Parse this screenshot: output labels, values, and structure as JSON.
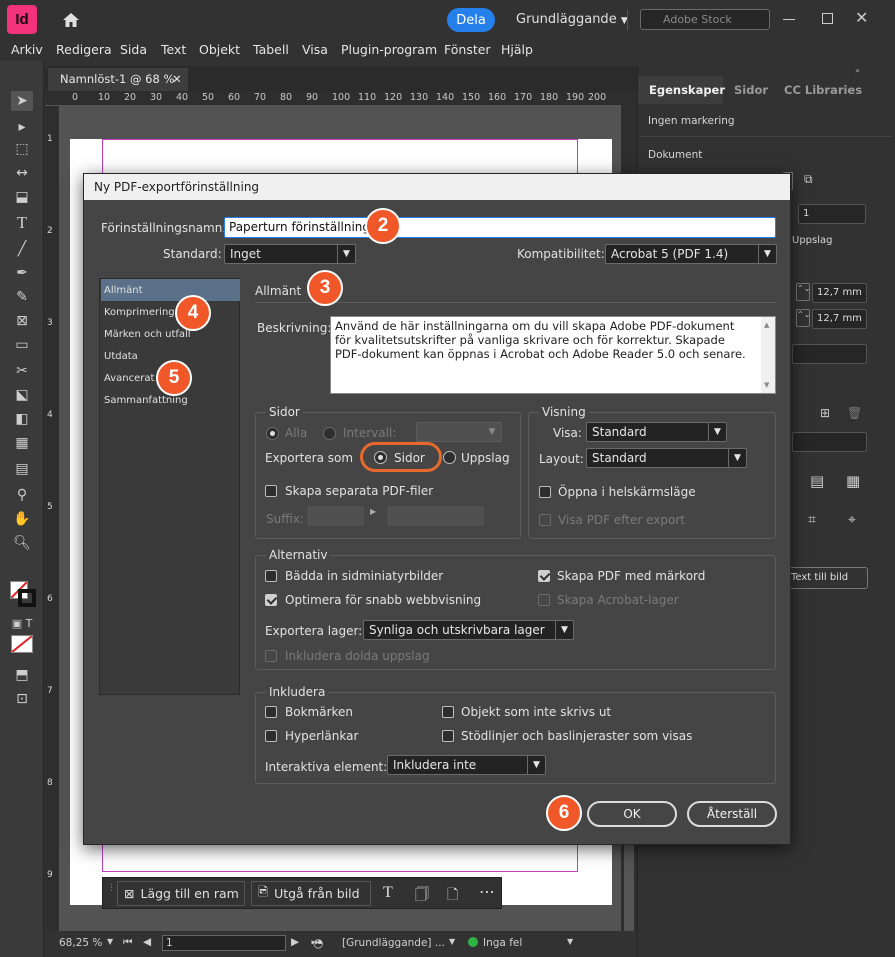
{
  "app": {
    "logo": "Id",
    "share": "Dela",
    "workspace": "Grundläggande",
    "stock_placeholder": "Adobe Stock"
  },
  "menu": [
    "Arkiv",
    "Redigera",
    "Sida",
    "Text",
    "Objekt",
    "Tabell",
    "Visa",
    "Plugin-program",
    "Fönster",
    "Hjälp"
  ],
  "doc": {
    "tab": "Namnlöst-1 @ 68 %",
    "ruler_ticks": [
      "0",
      "10",
      "20",
      "30",
      "40",
      "50",
      "60",
      "70",
      "80",
      "90",
      "100",
      "110",
      "120",
      "130",
      "140",
      "150",
      "160",
      "170",
      "180",
      "190",
      "200"
    ],
    "vruler_ticks": [
      "1",
      "2",
      "3",
      "4",
      "5",
      "6",
      "7",
      "8",
      "9"
    ]
  },
  "context_bar": {
    "add_frame": "Lägg till en ram",
    "from_image": "Utgå från bild"
  },
  "status": {
    "zoom": "68,25 %",
    "page": "1",
    "profile": "[Grundläggande] ...",
    "errors": "Inga fel"
  },
  "panel": {
    "tabs": [
      "Egenskaper",
      "Sidor",
      "CC Libraries"
    ],
    "no_selection": "Ingen markering",
    "document": "Dokument",
    "pages_value": "1",
    "spreads": "Uppslag",
    "margin1": "12,7 mm",
    "margin2": "12,7 mm",
    "text_to_image": "Text till bild"
  },
  "dialog": {
    "title": "Ny PDF-exportförinställning",
    "preset_label": "Förinställningsnamn:",
    "preset_value": "Paperturn förinställning",
    "standard_label": "Standard:",
    "standard_value": "Inget",
    "compat_label": "Kompatibilitet:",
    "compat_value": "Acrobat 5 (PDF 1.4)",
    "nav": [
      "Allmänt",
      "Komprimering",
      "Märken och utfall",
      "Utdata",
      "Avancerat",
      "Sammanfattning"
    ],
    "section": "Allmänt",
    "desc_label": "Beskrivning:",
    "desc": "Använd de här inställningarna om du vill skapa Adobe PDF-dokument för kvalitetsutskrifter på vanliga skrivare och för korrektur.  Skapade PDF-dokument kan öppnas i Acrobat och Adobe Reader 5.0 och senare.",
    "pages": {
      "title": "Sidor",
      "all": "Alla",
      "range": "Intervall:",
      "export_as": "Exportera som",
      "pages_opt": "Sidor",
      "spreads_opt": "Uppslag",
      "separate": "Skapa separata PDF-filer",
      "suffix": "Suffix:"
    },
    "view": {
      "title": "Visning",
      "view_label": "Visa:",
      "view_value": "Standard",
      "layout_label": "Layout:",
      "layout_value": "Standard",
      "fullscreen": "Öppna i helskärmsläge",
      "view_after": "Visa PDF efter export"
    },
    "options": {
      "title": "Alternativ",
      "thumbs": "Bädda in sidminiatyrbilder",
      "tagged": "Skapa PDF med märkord",
      "fastweb": "Optimera för snabb webbvisning",
      "acrolayers": "Skapa Acrobat-lager",
      "layers_label": "Exportera lager:",
      "layers_value": "Synliga och utskrivbara lager",
      "hidden": "Inkludera dolda uppslag"
    },
    "include": {
      "title": "Inkludera",
      "bookmarks": "Bokmärken",
      "nonprint": "Objekt som inte skrivs ut",
      "links": "Hyperlänkar",
      "guides": "Stödlinjer och baslinjeraster som visas",
      "interactive_label": "Interaktiva element:",
      "interactive_value": "Inkludera inte"
    },
    "ok": "OK",
    "reset": "Återställ"
  },
  "badges": [
    "2",
    "3",
    "4",
    "5",
    "6"
  ],
  "colors": {
    "accent": "#2680eb",
    "badge": "#f0582a",
    "logo": "#f2337b",
    "nav_selected": "#5a7189"
  }
}
